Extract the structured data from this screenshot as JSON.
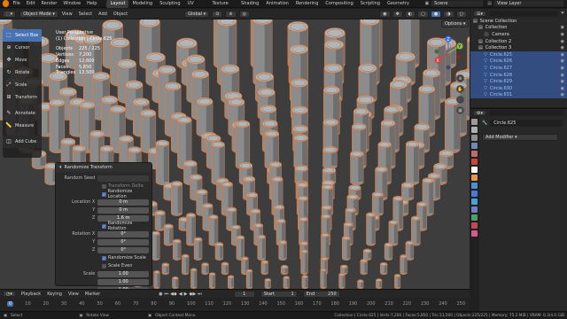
{
  "topbar": {
    "menus": [
      "File",
      "Edit",
      "Render",
      "Window",
      "Help"
    ],
    "workspaces": [
      "Layout",
      "Modeling",
      "Sculpting",
      "UV Editing",
      "Texture Paint",
      "Shading",
      "Animation",
      "Rendering",
      "Compositing",
      "Scripting",
      "Geometry Nodes"
    ],
    "scene": "Scene",
    "view_layer": "View Layer"
  },
  "viewport_header": {
    "mode": "Object Mode",
    "menus": [
      "View",
      "Select",
      "Add",
      "Object"
    ],
    "transform": "Global",
    "options": "Options"
  },
  "toolbar": {
    "tools": [
      "Select Box",
      "Cursor",
      "Move",
      "Rotate",
      "Scale",
      "Transform",
      "Annotate",
      "Measure"
    ],
    "add_cube": "Add Cube"
  },
  "viewport_info": {
    "view": "User Perspective",
    "collection_line": "(1) Collection | Circle.625",
    "stats": [
      {
        "k": "Objects",
        "v": "225 / 225"
      },
      {
        "k": "Vertices",
        "v": "7,200"
      },
      {
        "k": "Edges",
        "v": "12,600"
      },
      {
        "k": "Faces",
        "v": "5,850"
      },
      {
        "k": "Triangles",
        "v": "13,500"
      }
    ]
  },
  "gizmo": {
    "z": "Z",
    "y": "Y",
    "x": "X"
  },
  "redo_panel": {
    "title": "Randomize Transform",
    "random_seed_label": "Random Seed",
    "transform_delta": "Transform Delta",
    "randomize_location": "Randomize Location",
    "location_label": "Location X",
    "location": [
      {
        "axis": "",
        "value": "0 m"
      },
      {
        "axis": "Y",
        "value": "0 m"
      },
      {
        "axis": "Z",
        "value": "1.6 m"
      }
    ],
    "randomize_rotation": "Randomize Rotation",
    "rotation_label": "Rotation X",
    "rotation": [
      {
        "axis": "",
        "value": "0°"
      },
      {
        "axis": "Y",
        "value": "0°"
      },
      {
        "axis": "Z",
        "value": "0°"
      }
    ],
    "randomize_scale": "Randomize Scale",
    "scale_even": "Scale Even",
    "scale_label": "Scale",
    "scale": [
      "1.00",
      "1.00",
      "1.00"
    ]
  },
  "timeline": {
    "menus": [
      "Playback",
      "Keying",
      "View",
      "Marker"
    ],
    "current_frame": "1",
    "start_label": "Start",
    "start": "1",
    "end_label": "End",
    "end": "250",
    "ruler": [
      "0",
      "10",
      "20",
      "30",
      "40",
      "50",
      "60",
      "70",
      "80",
      "90",
      "100",
      "110",
      "120",
      "130",
      "140",
      "150",
      "160",
      "170",
      "180",
      "190",
      "200",
      "210",
      "220",
      "230",
      "240",
      "250"
    ]
  },
  "outliner": {
    "rows": [
      {
        "name": "Scene Collection",
        "sel": false
      },
      {
        "name": "Collection",
        "sel": false
      },
      {
        "name": "Camera",
        "sel": false
      },
      {
        "name": "Collection 2",
        "sel": false
      },
      {
        "name": "Collection 3",
        "sel": false
      },
      {
        "name": "Circle.625",
        "sel": true
      },
      {
        "name": "Circle.626",
        "sel": true
      },
      {
        "name": "Circle.627",
        "sel": true
      },
      {
        "name": "Circle.628",
        "sel": true
      },
      {
        "name": "Circle.629",
        "sel": true
      },
      {
        "name": "Circle.630",
        "sel": true
      },
      {
        "name": "Circle.631",
        "sel": true
      }
    ]
  },
  "properties": {
    "object_name": "Circle.625",
    "add_modifier": "Add Modifier"
  },
  "statusbar": {
    "select": "Select",
    "rotate": "Rotate View",
    "context": "Object Context Menu",
    "stats": "Collection | Circle.625 | Verts:7,200 | Faces:5,850 | Tris:13,500 | Objects:225/225 | Memory: 75.2 MiB | VRAM: 0.3/4.0 GiB"
  },
  "colors": {
    "accent": "#4772b3",
    "selection": "#e07a3a",
    "active": "#f5a623"
  }
}
